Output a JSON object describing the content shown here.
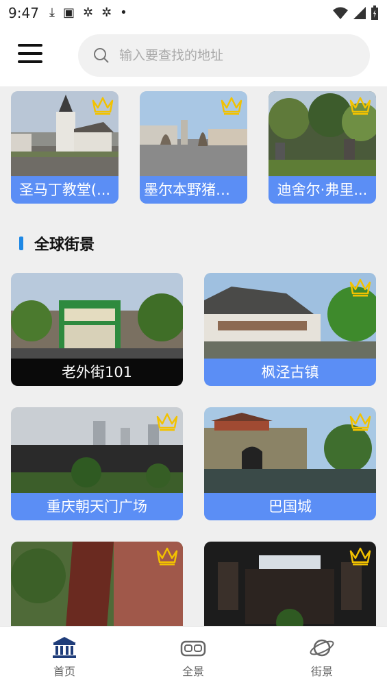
{
  "status": {
    "time": "9:47"
  },
  "search": {
    "placeholder": "输入要查找的地址"
  },
  "top_cards": [
    {
      "label": "圣马丁教堂(..."
    },
    {
      "label": "墨尔本野猪广..."
    },
    {
      "label": "迪舍尔·弗里..."
    }
  ],
  "section": {
    "title": "全球街景"
  },
  "grid_cards": [
    {
      "label": "老外街101"
    },
    {
      "label": "枫泾古镇"
    },
    {
      "label": "重庆朝天门广场"
    },
    {
      "label": "巴国城"
    }
  ],
  "tabs": [
    {
      "label": "首页",
      "icon": "bank-icon"
    },
    {
      "label": "全景",
      "icon": "vr-headset-icon"
    },
    {
      "label": "街景",
      "icon": "planet-icon"
    }
  ],
  "colors": {
    "accent": "#5b8ef5",
    "section_bar": "#1e88e5",
    "crown": "#f2c200"
  }
}
